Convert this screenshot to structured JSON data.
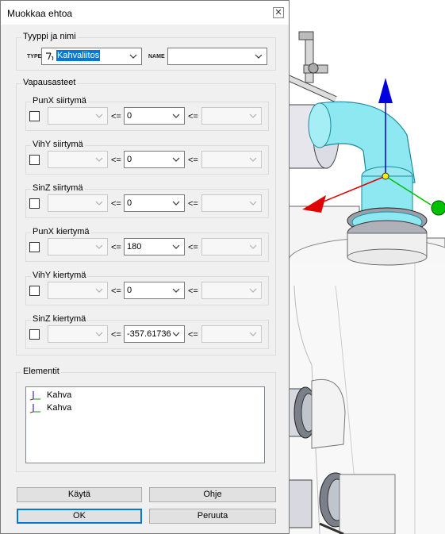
{
  "dialog": {
    "title": "Muokkaa ehtoa",
    "close_glyph": "✕"
  },
  "type_name": {
    "title": "Tyyppi ja nimi",
    "type_label": "TYPE",
    "type_value": "Kahvaliitos",
    "type_icon": "connection-icon",
    "name_label": "NAME",
    "name_value": ""
  },
  "dof": {
    "title": "Vapausasteet",
    "operator": "<=",
    "rows": [
      {
        "label": "PunX siirtymä",
        "checked": false,
        "value": "0"
      },
      {
        "label": "VihY siirtymä",
        "checked": false,
        "value": "0"
      },
      {
        "label": "SinZ siirtymä",
        "checked": false,
        "value": "0"
      },
      {
        "label": "PunX kiertymä",
        "checked": false,
        "value": "180"
      },
      {
        "label": "VihY kiertymä",
        "checked": false,
        "value": "0"
      },
      {
        "label": "SinZ kiertymä",
        "checked": false,
        "value": "-357.61736"
      }
    ]
  },
  "elements": {
    "title": "Elementit",
    "items": [
      {
        "label": "Kahva",
        "icon": "axes-icon"
      },
      {
        "label": "Kahva",
        "icon": "axes-icon"
      }
    ]
  },
  "buttons": {
    "apply": "Käytä",
    "help": "Ohje",
    "ok": "OK",
    "cancel": "Peruuta"
  },
  "colors": {
    "accent": "#0078d7",
    "pipe_highlight": "#80e8f0",
    "axis_x": "#e00000",
    "axis_y": "#00c000",
    "axis_z": "#0000e0"
  }
}
